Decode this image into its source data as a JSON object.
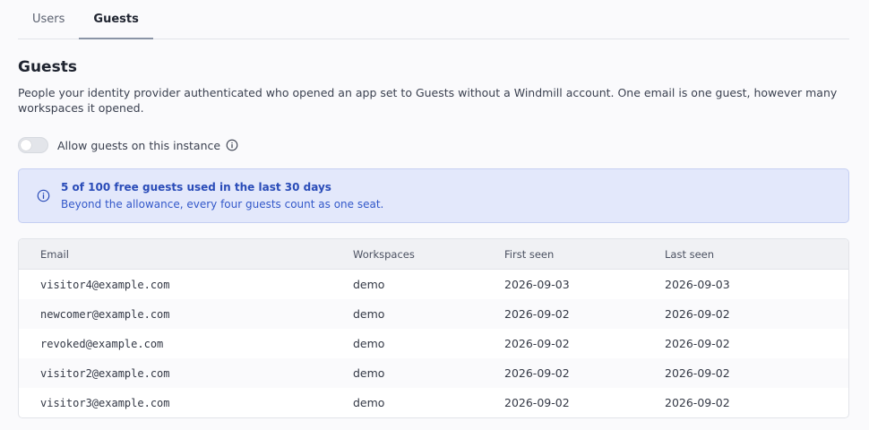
{
  "tabs": [
    {
      "label": "Users",
      "active": false
    },
    {
      "label": "Guests",
      "active": true
    }
  ],
  "section": {
    "title": "Guests",
    "description": "People your identity provider authenticated who opened an app set to Guests without a Windmill account. One email is one guest, however many workspaces it opened."
  },
  "toggle": {
    "label": "Allow guests on this instance",
    "enabled": false,
    "icon": "info-icon"
  },
  "alert": {
    "icon": "info-icon",
    "title": "5 of 100 free guests used in the last 30 days",
    "body": "Beyond the allowance, every four guests count as one seat.",
    "accent_color": "#2a4cb8"
  },
  "table": {
    "columns": [
      "Email",
      "Workspaces",
      "First seen",
      "Last seen"
    ],
    "rows": [
      {
        "email": "visitor4@example.com",
        "workspaces": "demo",
        "first_seen": "2026-09-03",
        "last_seen": "2026-09-03"
      },
      {
        "email": "newcomer@example.com",
        "workspaces": "demo",
        "first_seen": "2026-09-02",
        "last_seen": "2026-09-02"
      },
      {
        "email": "revoked@example.com",
        "workspaces": "demo",
        "first_seen": "2026-09-02",
        "last_seen": "2026-09-02"
      },
      {
        "email": "visitor2@example.com",
        "workspaces": "demo",
        "first_seen": "2026-09-02",
        "last_seen": "2026-09-02"
      },
      {
        "email": "visitor3@example.com",
        "workspaces": "demo",
        "first_seen": "2026-09-02",
        "last_seen": "2026-09-02"
      }
    ]
  }
}
